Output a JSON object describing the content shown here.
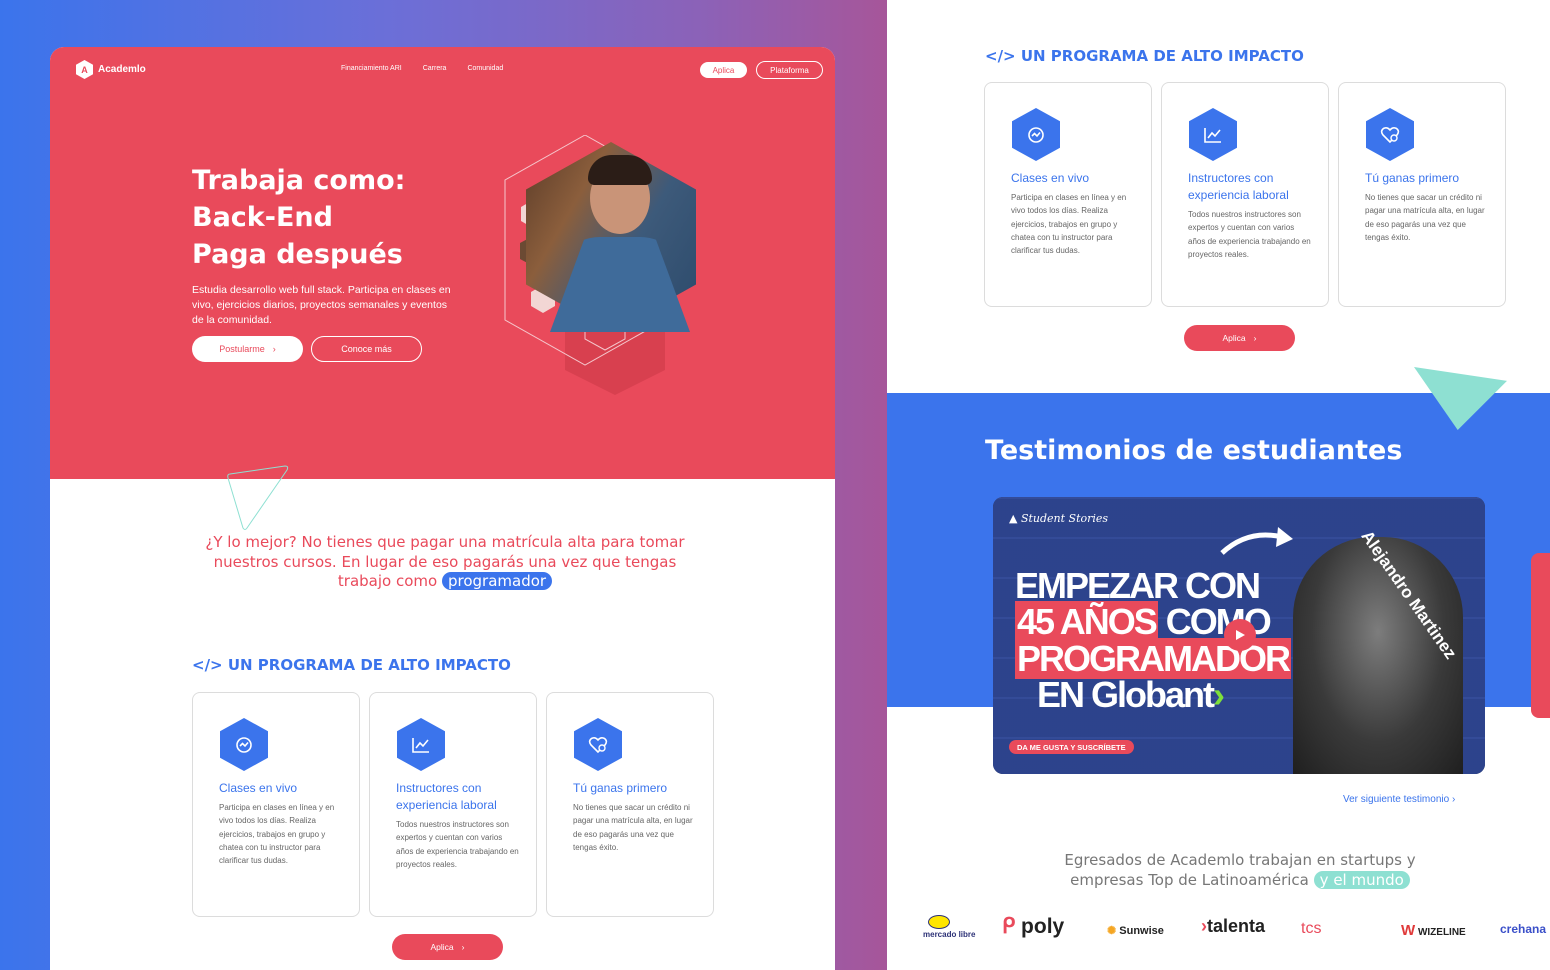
{
  "left": {
    "nav": {
      "brand": "Academlo",
      "links": [
        "Financiamiento ARI",
        "Carrera",
        "Comunidad"
      ],
      "apply_label": "Aplica",
      "platform_label": "Plataforma"
    },
    "hero": {
      "title_line1": "Trabaja como:",
      "title_line2": "Back-End",
      "title_line3": "Paga después",
      "subtitle": "Estudia desarrollo web full stack. Participa en clases en vivo, ejercicios diarios, proyectos semanales y eventos de la comunidad.",
      "primary_cta": "Postularme",
      "secondary_cta": "Conoce más"
    },
    "statement": {
      "text": "¿Y lo mejor? No tienes que pagar una matrícula alta para tomar nuestros cursos. En lugar de eso pagarás una vez que tengas trabajo como",
      "highlight": "programador"
    },
    "program": {
      "title": "</> UN PROGRAMA DE ALTO IMPACTO",
      "cards": [
        {
          "title": "Clases en vivo",
          "text": "Participa en clases en línea y en vivo todos los días. Realiza ejercicios, trabajos en grupo y chatea con tu instructor para clarificar tus dudas.",
          "icon": "live-class-icon"
        },
        {
          "title": "Instructores con experiencia laboral",
          "text": "Todos nuestros instructores son expertos y cuentan con varios años de experiencia trabajando en proyectos reales.",
          "icon": "chart-icon"
        },
        {
          "title": "Tú ganas primero",
          "text": "No tienes que sacar un crédito ni pagar una matrícula alta, en lugar de eso pagarás una vez que tengas éxito.",
          "icon": "heart-icon"
        }
      ],
      "apply_label": "Aplica"
    }
  },
  "right": {
    "program": {
      "title": "</> UN PROGRAMA DE ALTO IMPACTO",
      "cards": [
        {
          "title": "Clases en vivo",
          "text": "Participa en clases en línea y en vivo todos los días. Realiza ejercicios, trabajos en grupo y chatea con tu instructor para clarificar tus dudas."
        },
        {
          "title": "Instructores con experiencia laboral",
          "text": "Todos nuestros instructores son expertos y cuentan con varios años de experiencia trabajando en proyectos reales."
        },
        {
          "title": "Tú ganas primero",
          "text": "No tienes que sacar un crédito ni pagar una matrícula alta, en lugar de eso pagarás una vez que tengas éxito."
        }
      ],
      "apply_label": "Aplica"
    },
    "testimonials": {
      "title": "Testimonios de estudiantes",
      "video": {
        "brand": "Student Stories",
        "line1": "EMPEZAR CON",
        "line2a": "45 AÑOS",
        "line2b": "COMO",
        "line3": "PROGRAMADOR",
        "line4": "EN Globant",
        "name": "Alejandro Martinez",
        "subscribe": "DA ME GUSTA Y SUSCRÍBETE"
      },
      "next_label": "Ver siguiente testimonio"
    },
    "graduates": {
      "text": "Egresados de Academlo trabajan en startups y empresas Top de Latinoamérica",
      "highlight": "y el mundo"
    },
    "companies": [
      "mercado libre",
      "poly",
      "Sunwise",
      "talenta",
      "tcs",
      "WIZELINE",
      "crehana"
    ]
  },
  "colors": {
    "brand_red": "#e94a5b",
    "brand_blue": "#3b74ec",
    "teal_accent": "#8ee0d2"
  }
}
